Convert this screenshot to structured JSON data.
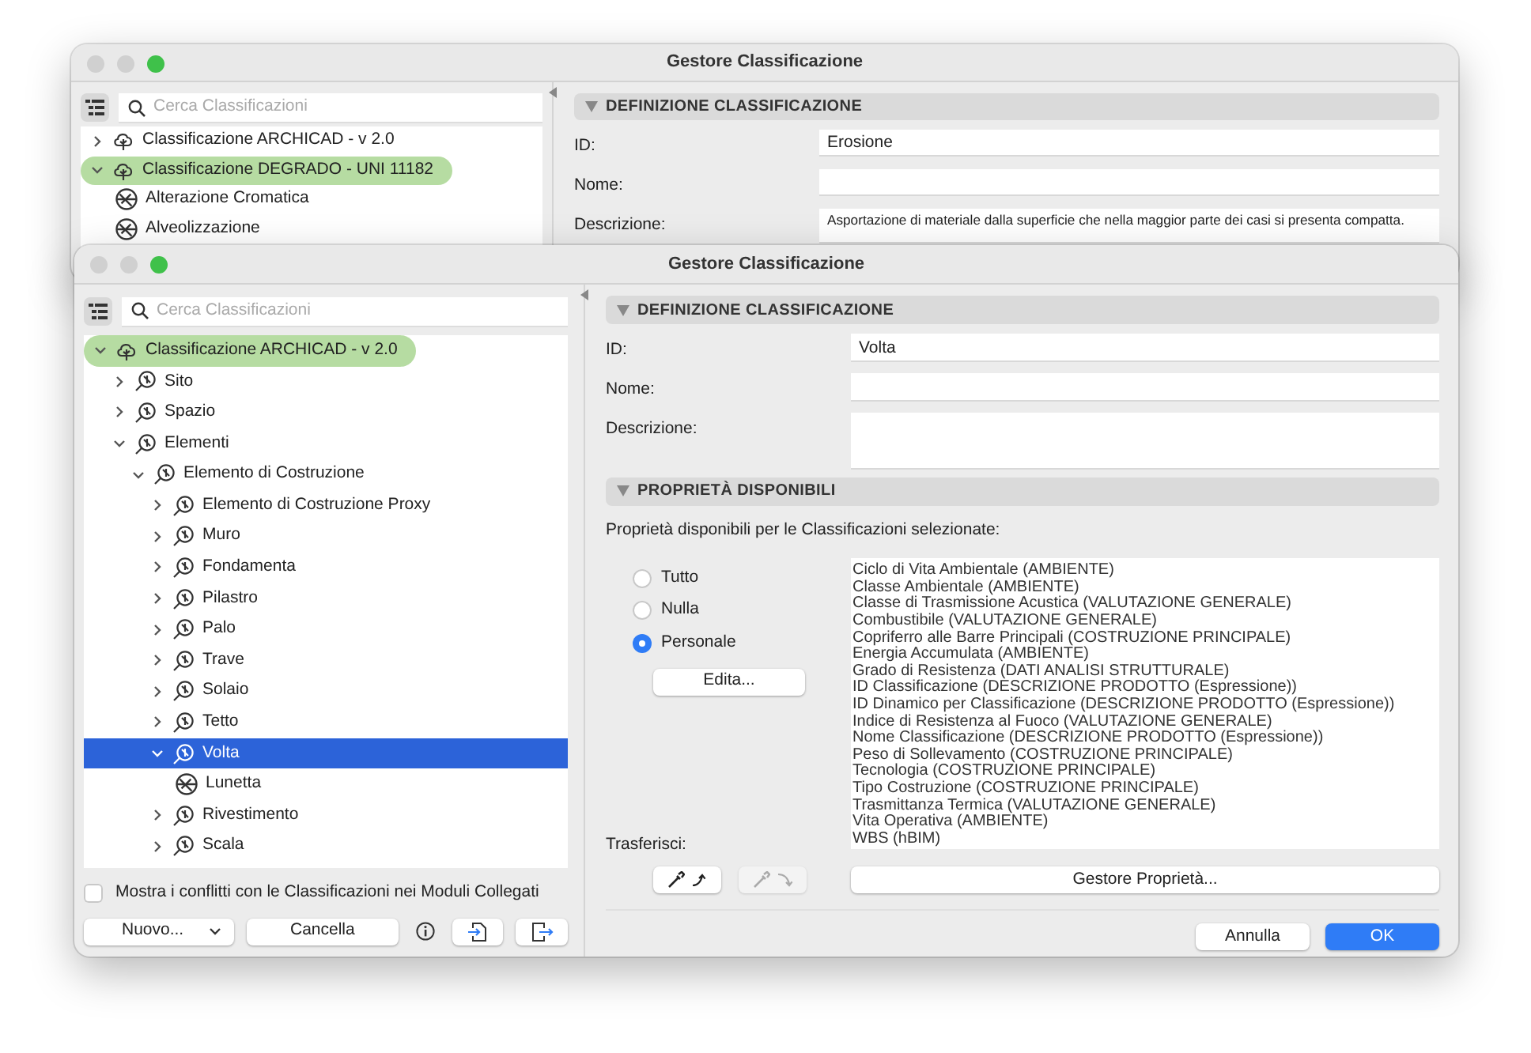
{
  "background_window": {
    "title": "Gestore Classificazione",
    "search": {
      "placeholder": "Cerca Classificazioni"
    },
    "tree": [
      {
        "label": "Classificazione ARCHICAD - v 2.0",
        "kind": "root",
        "expanded": false,
        "highlighted": false,
        "selected": false
      },
      {
        "label": "Classificazione DEGRADO - UNI 11182",
        "kind": "root",
        "expanded": true,
        "highlighted": true,
        "selected": false,
        "children": [
          {
            "label": "Alterazione Cromatica",
            "kind": "leaf",
            "selected": false
          },
          {
            "label": "Alveolizzazione",
            "kind": "leaf",
            "selected": false
          }
        ]
      }
    ],
    "definition": {
      "header": "DEFINIZIONE CLASSIFICAZIONE",
      "fields": [
        {
          "label": "ID:",
          "kind": "line",
          "value": "Erosione"
        },
        {
          "label": "Nome:",
          "kind": "line"
        },
        {
          "label": "Descrizione:",
          "kind": "multiline",
          "value": "Asportazione di materiale dalla superficie che nella maggior parte dei casi si presenta compatta."
        }
      ]
    }
  },
  "window": {
    "title": "Gestore Classificazione",
    "search": {
      "placeholder": "Cerca Classificazioni"
    },
    "tree": [
      {
        "label": "Classificazione ARCHICAD - v 2.0",
        "kind": "root",
        "expanded": true,
        "highlighted": true,
        "selected": false,
        "children": [
          {
            "label": "Sito",
            "kind": "branch",
            "expanded": false,
            "selected": false
          },
          {
            "label": "Spazio",
            "kind": "branch",
            "expanded": false,
            "selected": false
          },
          {
            "label": "Elementi",
            "kind": "branch",
            "expanded": true,
            "selected": false,
            "children": [
              {
                "label": "Elemento di Costruzione",
                "kind": "branch",
                "expanded": true,
                "selected": false,
                "children": [
                  {
                    "label": "Elemento di Costruzione Proxy",
                    "kind": "branch",
                    "expanded": false,
                    "selected": false
                  },
                  {
                    "label": "Muro",
                    "kind": "branch",
                    "expanded": false,
                    "selected": false
                  },
                  {
                    "label": "Fondamenta",
                    "kind": "branch",
                    "expanded": false,
                    "selected": false
                  },
                  {
                    "label": "Pilastro",
                    "kind": "branch",
                    "expanded": false,
                    "selected": false
                  },
                  {
                    "label": "Palo",
                    "kind": "branch",
                    "expanded": false,
                    "selected": false
                  },
                  {
                    "label": "Trave",
                    "kind": "branch",
                    "expanded": false,
                    "selected": false
                  },
                  {
                    "label": "Solaio",
                    "kind": "branch",
                    "expanded": false,
                    "selected": false
                  },
                  {
                    "label": "Tetto",
                    "kind": "branch",
                    "expanded": false,
                    "selected": false
                  },
                  {
                    "label": "Volta",
                    "kind": "branch",
                    "expanded": true,
                    "selected": true,
                    "children": [
                      {
                        "label": "Lunetta",
                        "kind": "leaf",
                        "selected": false
                      }
                    ]
                  },
                  {
                    "label": "Rivestimento",
                    "kind": "branch",
                    "expanded": false,
                    "selected": false
                  },
                  {
                    "label": "Scala",
                    "kind": "branch",
                    "expanded": false,
                    "selected": false
                  }
                ]
              }
            ]
          }
        ]
      }
    ],
    "conflicts_checkbox": {
      "label": "Mostra i conflitti con le Classificazioni nei Moduli Collegati",
      "checked": false
    },
    "new_button": "Nuovo...",
    "delete_button": "Cancella",
    "definition": {
      "header": "DEFINIZIONE CLASSIFICAZIONE",
      "fields": [
        {
          "label": "ID:",
          "kind": "line",
          "value": "Volta"
        },
        {
          "label": "Nome:",
          "kind": "line"
        },
        {
          "label": "Descrizione:",
          "kind": "multiline"
        }
      ]
    },
    "properties": {
      "header": "PROPRIETÀ DISPONIBILI",
      "caption": "Proprietà disponibili per le Classificazioni selezionate:",
      "options": [
        {
          "label": "Tutto",
          "selected": false
        },
        {
          "label": "Nulla",
          "selected": false
        },
        {
          "label": "Personale",
          "selected": true
        }
      ],
      "edit_button": "Edita...",
      "list": [
        "Ciclo di Vita Ambientale (AMBIENTE)",
        "Classe Ambientale (AMBIENTE)",
        "Classe di Trasmissione Acustica (VALUTAZIONE GENERALE)",
        "Combustibile (VALUTAZIONE GENERALE)",
        "Copriferro alle Barre Principali (COSTRUZIONE PRINCIPALE)",
        "Energia Accumulata (AMBIENTE)",
        "Grado di Resistenza (DATI ANALISI STRUTTURALE)",
        "ID Classificazione (DESCRIZIONE PRODOTTO (Espressione))",
        "ID Dinamico per Classificazione (DESCRIZIONE PRODOTTO (Espressione))",
        "Indice di Resistenza al Fuoco (VALUTAZIONE GENERALE)",
        "Nome Classificazione (DESCRIZIONE PRODOTTO (Espressione))",
        "Peso di Sollevamento (COSTRUZIONE PRINCIPALE)",
        "Tecnologia (COSTRUZIONE PRINCIPALE)",
        "Tipo Costruzione (COSTRUZIONE PRINCIPALE)",
        "Trasmittanza Termica (VALUTAZIONE GENERALE)",
        "Vita Operativa (AMBIENTE)",
        "WBS (hBIM)"
      ],
      "transfer_label": "Trasferisci:",
      "transfer_buttons": [
        {
          "kind": "up",
          "disabled": false
        },
        {
          "kind": "down",
          "disabled": true
        }
      ],
      "manager_button": "Gestore Proprietà..."
    },
    "cancel_button": "Annulla",
    "ok_button": "OK"
  }
}
